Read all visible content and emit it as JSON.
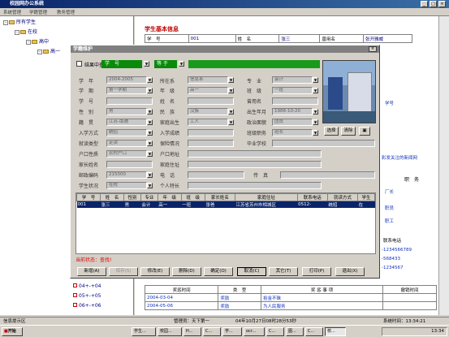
{
  "window": {
    "title": "校园网办公系统",
    "menu_items": [
      "系统管理",
      "学籍管理",
      "教务管理"
    ]
  },
  "tree": {
    "root": "所有学生",
    "items": [
      {
        "label": "在校",
        "level": 1
      },
      {
        "label": "高中",
        "level": 2
      },
      {
        "label": "高一",
        "level": 3
      }
    ],
    "bottom_items": [
      "04+-+04",
      "05+-+05",
      "06+-+06"
    ]
  },
  "right_panel": {
    "title": "学生基本信息",
    "row1": {
      "xh_label": "学　号",
      "xh_value": "001",
      "xm_label": "姓　名",
      "xm_value": "张三",
      "cym_label": "曾用名",
      "cym_value": "张开雅威"
    },
    "side_texts": [
      "学号",
      "彩发关注的新闻网",
      "职　务",
      "厂长",
      "职员",
      "职工",
      "联系电话",
      "-1234566789",
      "-568433",
      "-1234567"
    ],
    "awards": {
      "headers": [
        "奖惩时间",
        "类　型",
        "奖 惩 事 项",
        "撤销时间"
      ],
      "rows": [
        {
          "date": "2004-03-04",
          "type": "奖励",
          "item": "拾金不昧"
        },
        {
          "date": "2004-05-06",
          "type": "奖励",
          "item": "为人民服务"
        }
      ]
    }
  },
  "dialog": {
    "title": "学籍维护",
    "search": {
      "checkbox_label": "结果中查",
      "field": "学　号",
      "operator": "等 于",
      "value": ""
    },
    "labels": {
      "xue_nian": "学　年",
      "xue_qi": "学　期",
      "xue_hao": "学　号",
      "xing_bie": "性　别",
      "ji_guan": "籍　贯",
      "ru_xue_fang_shi": "入学方式",
      "jiu_du_lei_xing": "就读类型",
      "hu_kou_xing_zhi": "户口性质",
      "jia_zhang_xing_ming": "家长姓名",
      "you_zheng_bian_ma": "邮政编码",
      "xue_sheng_zhuang_kuang": "学生状况",
      "suo_zai_dong": "所在系",
      "nian_ji": "年　级",
      "xing_ming": "姓　名",
      "min_zu": "民　族",
      "jia_ting_chu_sheng": "家庭出生",
      "ru_xue_cheng_ji": "入学成绩",
      "bao_xian_qing_kuang": "保险情况",
      "hu_kou_di_zhi": "户口地址",
      "jia_zhu_di_zhi": "家庭住址",
      "dian_hua": "电　话",
      "ge_ren_te_chang": "个人特长",
      "zhuan_ye": "专　业",
      "ban_ji": "班　级",
      "ceng_yong_ming": "曾用名",
      "chu_sheng_nian_yue": "出生年月",
      "zheng_zhi_mian_mao": "政治面貌",
      "ban_ji_zhi_wu": "班级职务",
      "bi_ye_xue_xiao": "毕业学校",
      "chuan_zhen": "传　真"
    },
    "values": {
      "xue_nian": "2004-2005",
      "xue_qi": "第一学期",
      "xing_bie": "男",
      "ji_guan": "江苏-南通",
      "ru_xue_fang_shi": "统招",
      "jiu_du_lei_xing": "走读",
      "hu_kou_xing_zhi": "农村户口",
      "you_zheng_bian_ma": "215000",
      "xue_sheng_zhuang_kuang": "在校",
      "suo_zai_dong": "信息系",
      "nian_ji": "高一",
      "min_zu": "汉族",
      "jia_ting_chu_sheng": "工人",
      "zhuan_ye": "会计",
      "ban_ji": "一班",
      "chu_sheng_nian_yue": "1988-10-20",
      "zheng_zhi_mian_mao": "团员",
      "ban_ji_zhi_wu": "班长"
    },
    "photo_buttons": [
      "选择",
      "清除"
    ],
    "table": {
      "headers": [
        "学　号",
        "姓　名",
        "性别",
        "专业",
        "年　级",
        "班　级",
        "家长姓名",
        "家庭住址",
        "联系电话",
        "就读方式",
        "学生"
      ],
      "rows": [
        [
          "001",
          "张三",
          "男",
          "会计",
          "高一",
          "一班",
          "张爸",
          "江苏省苏州市相城区",
          "0512-",
          "统招",
          "在"
        ]
      ]
    },
    "status_text": "当前状态：查找!",
    "buttons": [
      "新增(A)",
      "保存(S)",
      "修改(E)",
      "删除(D)",
      "确定(O)",
      "取消(C)",
      "其它(T)",
      "打印(P)",
      "退出(X)"
    ]
  },
  "statusbar": {
    "left": "信息提示区",
    "user": "管理员：天下第一",
    "date": "04年10月27日08时28分53秒",
    "time_label": "系统时间：13:34:21"
  },
  "taskbar": {
    "start": "开始",
    "items": [
      "学生...",
      "校园...",
      "H...",
      "C...",
      "学...",
      "ocr...",
      "C...",
      "图...",
      "C...",
      "校..."
    ],
    "clock": "13:34"
  }
}
